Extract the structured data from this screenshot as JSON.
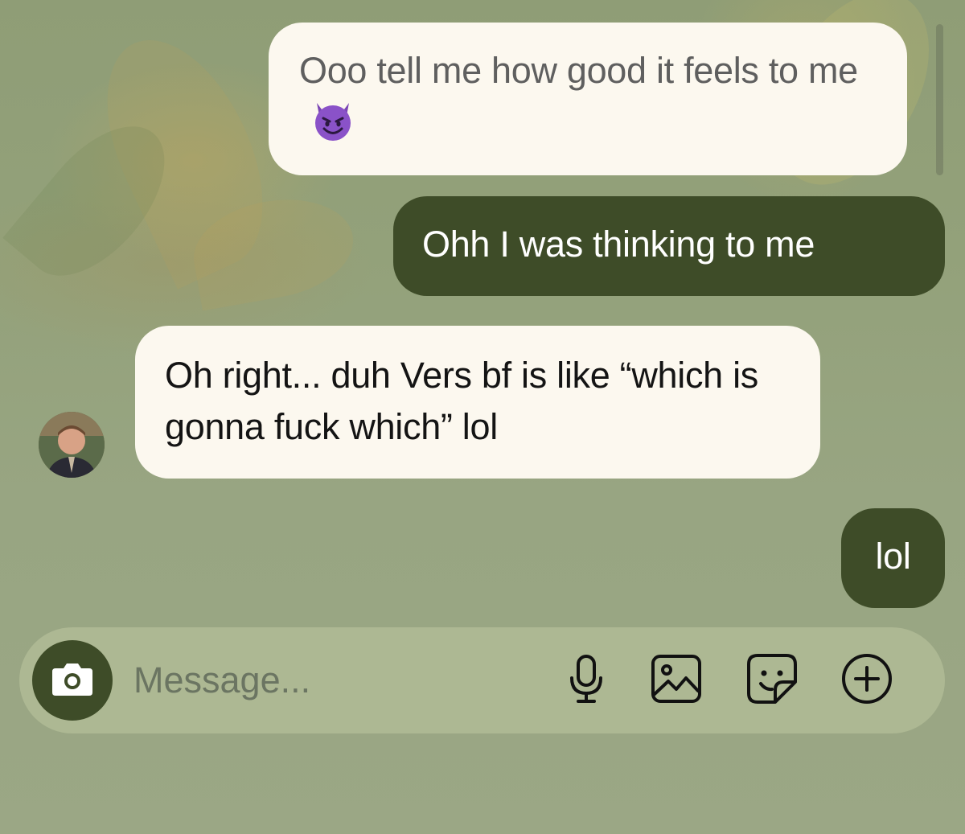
{
  "messages": [
    {
      "sender": "them",
      "text": "Ooo tell me how good it feels to me",
      "emoji": "smiling-imp",
      "faded": true
    },
    {
      "sender": "me",
      "text": "Ohh I was thinking to me"
    },
    {
      "sender": "them",
      "text": "Oh right... duh Vers bf is like “which is gonna fuck which” lol"
    },
    {
      "sender": "me",
      "text": "lol"
    }
  ],
  "composer": {
    "placeholder": "Message...",
    "icons": [
      "camera-icon",
      "microphone-icon",
      "image-icon",
      "sticker-icon",
      "plus-circle-icon"
    ]
  },
  "colors": {
    "sent_bubble": "#3e4c28",
    "received_bubble": "#fcf8ef",
    "composer": "#adb893",
    "background": "#9aa684"
  }
}
